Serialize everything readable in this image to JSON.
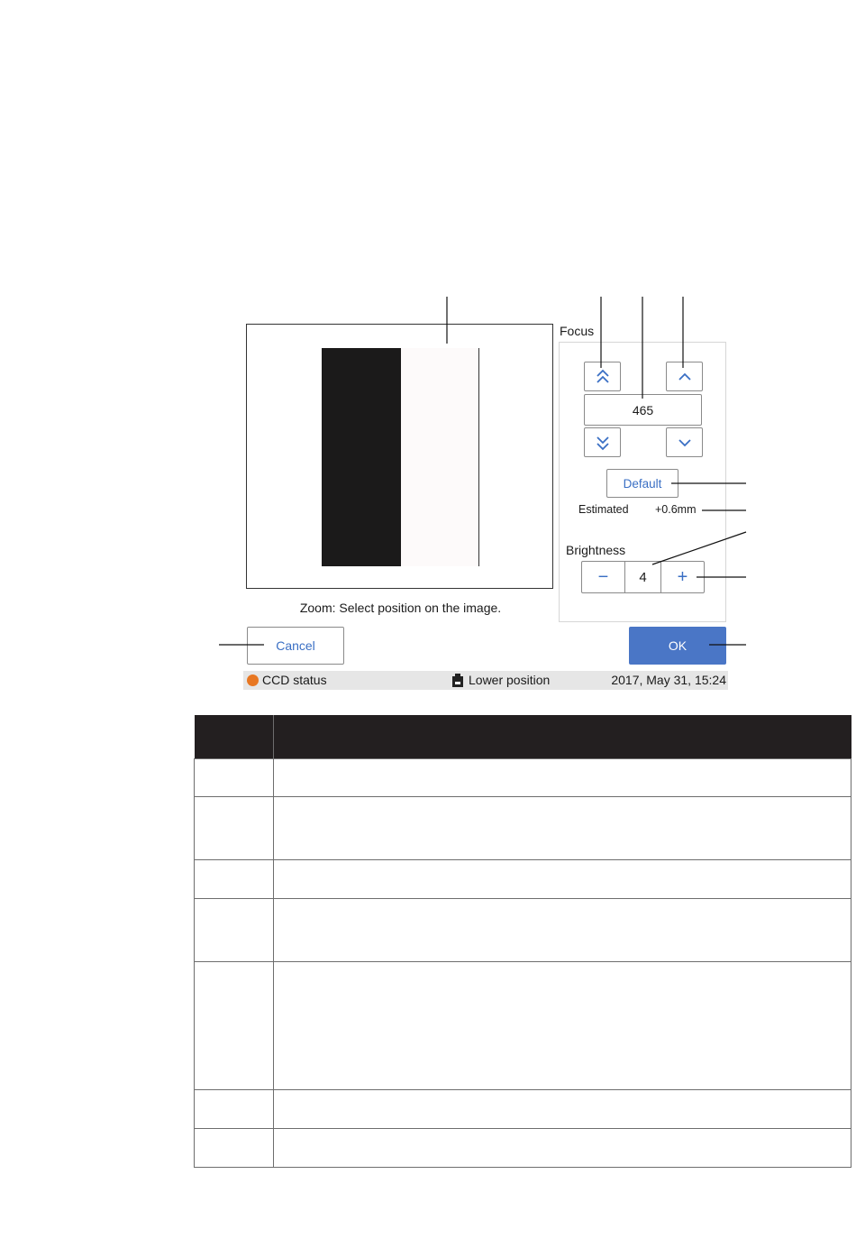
{
  "focus": {
    "label": "Focus",
    "value": "465",
    "default_label": "Default",
    "estimated_label": "Estimated",
    "estimated_value": "+0.6mm"
  },
  "brightness": {
    "label": "Brightness",
    "minus": "−",
    "value": "4",
    "plus": "+"
  },
  "preview": {
    "zoom_hint": "Zoom: Select position on the image."
  },
  "actions": {
    "cancel_label": "Cancel",
    "ok_label": "OK"
  },
  "status_bar": {
    "ccd_status": "CCD status",
    "position": "Lower position",
    "datetime": "2017, May 31, 15:24",
    "ccd_color": "#e87722"
  },
  "colors": {
    "accent": "#4a76c6",
    "link_blue": "#3a6fc4",
    "table_header": "#231f20"
  },
  "icons": {
    "focus_coarse_up": "double-chevron-up-icon",
    "focus_fine_up": "chevron-up-icon",
    "focus_coarse_down": "double-chevron-down-icon",
    "focus_fine_down": "chevron-down-icon",
    "position": "stage-position-icon"
  },
  "table": {
    "header": [
      "",
      ""
    ],
    "rows": [
      [
        "",
        ""
      ],
      [
        "",
        ""
      ],
      [
        "",
        ""
      ],
      [
        "",
        ""
      ],
      [
        "",
        ""
      ],
      [
        "",
        ""
      ],
      [
        "",
        ""
      ]
    ]
  }
}
